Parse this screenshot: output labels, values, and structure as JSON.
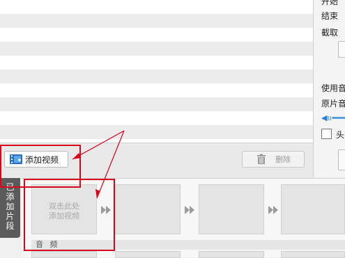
{
  "right_panel": {
    "labels": [
      "开始",
      "结束",
      "截取",
      "使用音",
      "原片音",
      "头"
    ]
  },
  "toolbar": {
    "add_video_label": "添加视频",
    "delete_label": "删除"
  },
  "sidetab": {
    "label": "已添加片段"
  },
  "timeline": {
    "placeholder_line1": "双击此处",
    "placeholder_line2": "添加视频",
    "audio_label": "音 频"
  }
}
